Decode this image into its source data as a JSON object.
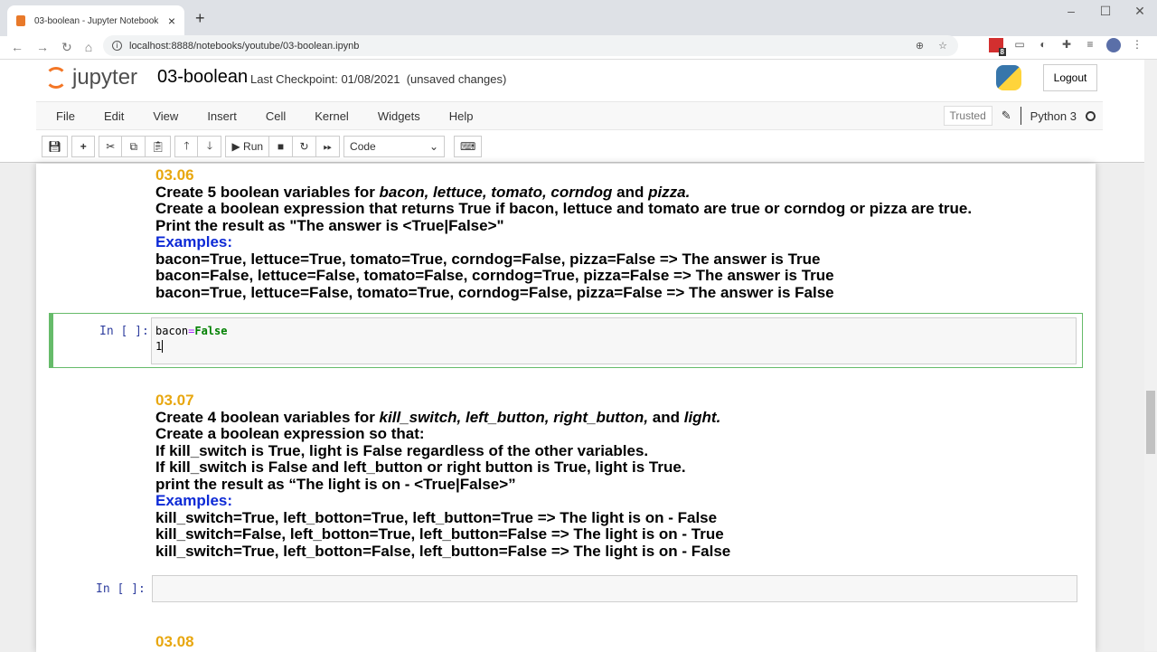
{
  "browser": {
    "tab_title": "03-boolean - Jupyter Notebook",
    "url": "localhost:8888/notebooks/youtube/03-boolean.ipynb",
    "ext_badge": "8"
  },
  "header": {
    "logo": "jupyter",
    "notebook_name": "03-boolean",
    "checkpoint": "Last Checkpoint: 01/08/2021  (unsaved changes)",
    "logout": "Logout"
  },
  "menu": [
    "File",
    "Edit",
    "View",
    "Insert",
    "Cell",
    "Kernel",
    "Widgets",
    "Help"
  ],
  "kernel": {
    "trusted": "Trusted",
    "name": "Python 3"
  },
  "toolbar": {
    "run": "Run",
    "cell_type": "Code"
  },
  "cells": {
    "md1": {
      "heading": "03.06",
      "l1a": "Create 5 boolean variables for ",
      "l1b": "bacon, lettuce, tomato, corndog",
      "l1c": " and ",
      "l1d": "pizza.",
      "l2": "Create a boolean expression that returns True if bacon, lettuce and tomato are true or corndog or pizza are true.",
      "l3": "Print the result as \"The answer is <True|False>\"",
      "examples": "Examples:",
      "e1": "bacon=True, lettuce=True, tomato=True, corndog=False, pizza=False => The answer is True",
      "e2": "bacon=False, lettuce=False, tomato=False, corndog=True, pizza=False => The answer is True",
      "e3": "bacon=True, lettuce=False, tomato=True, corndog=False, pizza=False => The answer is False"
    },
    "code1": {
      "prompt": "In [ ]:",
      "l1_var": "bacon",
      "l1_op": "=",
      "l1_val": "False",
      "l2": "1"
    },
    "md2": {
      "heading": "03.07",
      "l1a": "Create 4 boolean variables for ",
      "l1b": "kill_switch, left_button, right_button,",
      "l1c": " and ",
      "l1d": "light.",
      "l2": "Create a boolean expression so that:",
      "l3": "If kill_switch is True, light is False regardless of the other variables.",
      "l4": "If kill_switch is False and left_button or right button is True, light is True.",
      "l5": "print the result as “The light is on - <True|False>”",
      "examples": "Examples:",
      "e1": "kill_switch=True, left_botton=True, left_button=True => The light is on - False",
      "e2": "kill_switch=False, left_botton=True, left_button=False => The light is on - True",
      "e3": "kill_switch=True, left_botton=False, left_button=False => The light is on - False"
    },
    "code2": {
      "prompt": "In [ ]:"
    },
    "md3": {
      "heading": "03.08"
    }
  }
}
